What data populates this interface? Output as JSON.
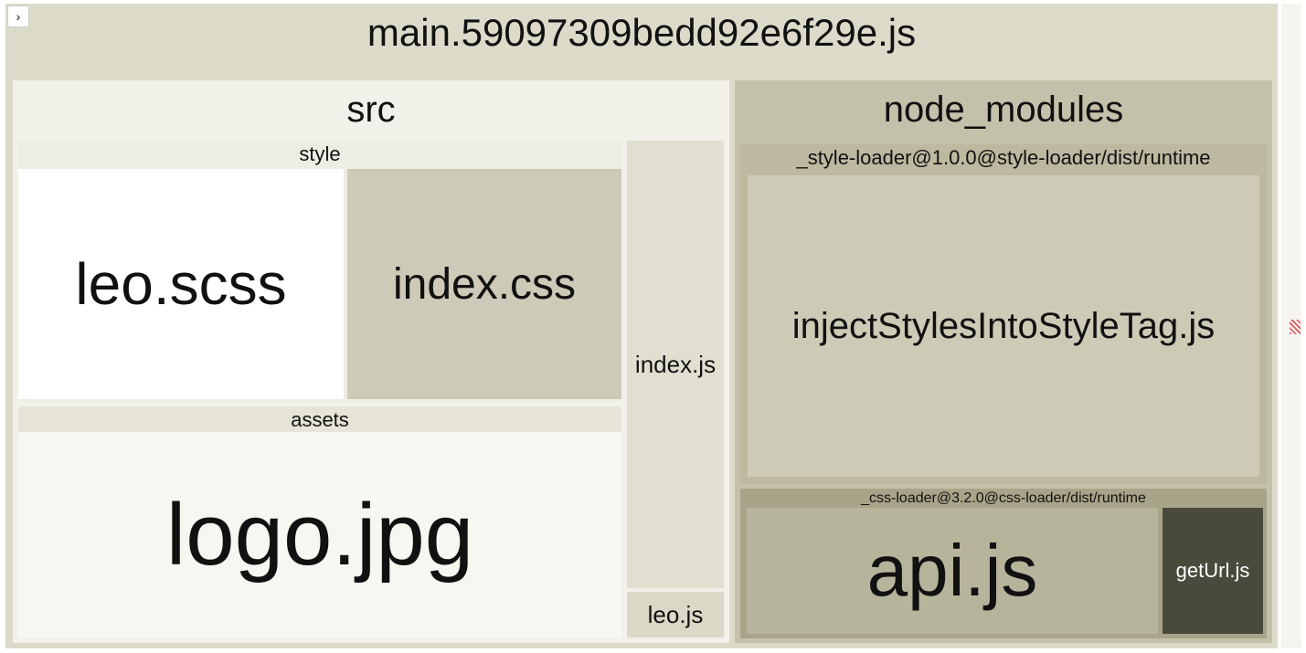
{
  "toggle": {
    "glyph": "›"
  },
  "root": {
    "name": "main.59097309bedd92e6f29e.js"
  },
  "src": {
    "name": "src",
    "style": {
      "name": "style",
      "leo_scss": "leo.scss",
      "index_css": "index.css"
    },
    "assets": {
      "name": "assets",
      "logo_jpg": "logo.jpg"
    },
    "index_js": "index.js",
    "leo_js": "leo.js"
  },
  "node_modules": {
    "name": "node_modules",
    "style_loader": {
      "name": "_style-loader@1.0.0@style-loader/dist/runtime",
      "inject": "injectStylesIntoStyleTag.js"
    },
    "css_loader": {
      "name": "_css-loader@3.2.0@css-loader/dist/runtime",
      "api_js": "api.js",
      "geturl_js": "getUrl.js"
    }
  }
}
